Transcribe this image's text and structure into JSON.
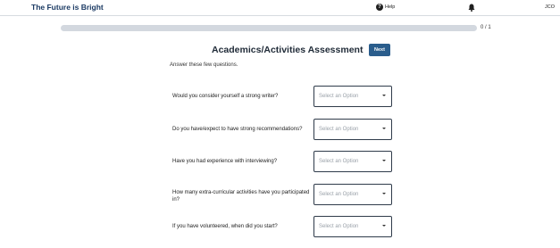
{
  "header": {
    "brand": "The Future is Bright",
    "help_label": "Help",
    "help_icon": "?",
    "user_initials": "JCO"
  },
  "progress": {
    "label": "0 / 1",
    "fraction": 0
  },
  "page": {
    "title": "Academics/Activities Assessment",
    "next_label": "Next",
    "intro": "Answer these few questions."
  },
  "questions": [
    {
      "label": "Would you consider yourself a strong writer?",
      "placeholder": "Select an Option"
    },
    {
      "label": "Do you have/expect to have strong recommendations?",
      "placeholder": "Select an Option"
    },
    {
      "label": "Have you had experience with interviewing?",
      "placeholder": "Select an Option"
    },
    {
      "label": "How many extra-curricular activities have you participated in?",
      "placeholder": "Select an Option"
    },
    {
      "label": "If you have volunteered, when did you start?",
      "placeholder": "Select an Option"
    }
  ],
  "colors": {
    "brand": "#1b3a63",
    "button": "#2a5d8c",
    "progress_track": "#d3d8df"
  }
}
